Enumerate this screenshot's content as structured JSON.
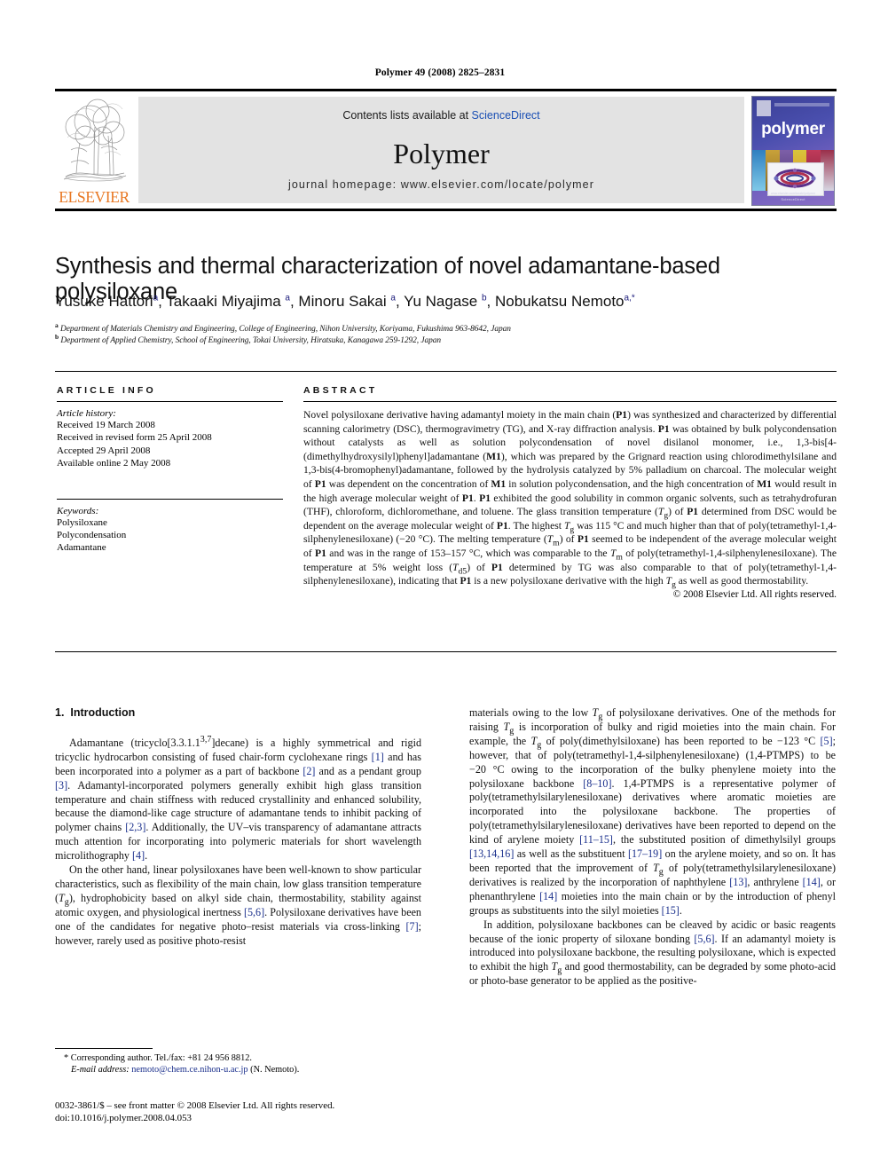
{
  "running_head": "Polymer 49 (2008) 2825–2831",
  "masthead": {
    "publisher_name": "ELSEVIER",
    "contents_prefix": "Contents lists available at ",
    "contents_link": "ScienceDirect",
    "journal_name": "Polymer",
    "homepage": "journal homepage: www.elsevier.com/locate/polymer",
    "cover_title": "polymer",
    "cover_footer": "ScienceDirect",
    "cover_caption": "www.elsevier.com/locate/polymer"
  },
  "article": {
    "title": "Synthesis and thermal characterization of novel adamantane-based polysiloxane",
    "authors_plain": "Yusuke Hattori a, Takaaki Miyajima a, Minoru Sakai a, Yu Nagase b, Nobukatsu Nemoto a,*",
    "affiliation_a": "Department of Materials Chemistry and Engineering, College of Engineering, Nihon University, Koriyama, Fukushima 963-8642, Japan",
    "affiliation_b": "Department of Applied Chemistry, School of Engineering, Tokai University, Hiratsuka, Kanagawa 259-1292, Japan"
  },
  "info": {
    "heading": "ARTICLE INFO",
    "history_label": "Article history:",
    "history": [
      "Received 19 March 2008",
      "Received in revised form 25 April 2008",
      "Accepted 29 April 2008",
      "Available online 2 May 2008"
    ],
    "keywords_label": "Keywords:",
    "keywords": [
      "Polysiloxane",
      "Polycondensation",
      "Adamantane"
    ]
  },
  "abstract": {
    "heading": "ABSTRACT",
    "copyright": "© 2008 Elsevier Ltd. All rights reserved."
  },
  "introduction": {
    "section_number": "1.",
    "section_title": "Introduction"
  },
  "footnote": {
    "corresponding": "* Corresponding author. Tel./fax: +81 24 956 8812.",
    "email_label": "E-mail address:",
    "email": "nemoto@chem.ce.nihon-u.ac.jp",
    "email_owner": "(N. Nemoto).",
    "imprint_line1": "0032-3861/$ – see front matter © 2008 Elsevier Ltd. All rights reserved.",
    "imprint_line2": "doi:10.1016/j.polymer.2008.04.053"
  },
  "colors": {
    "elsevier_orange": "#E87722",
    "link_blue": "#1a4fb4",
    "reference_blue": "#1a2f8c",
    "band_grey": "#e3e3e3"
  }
}
